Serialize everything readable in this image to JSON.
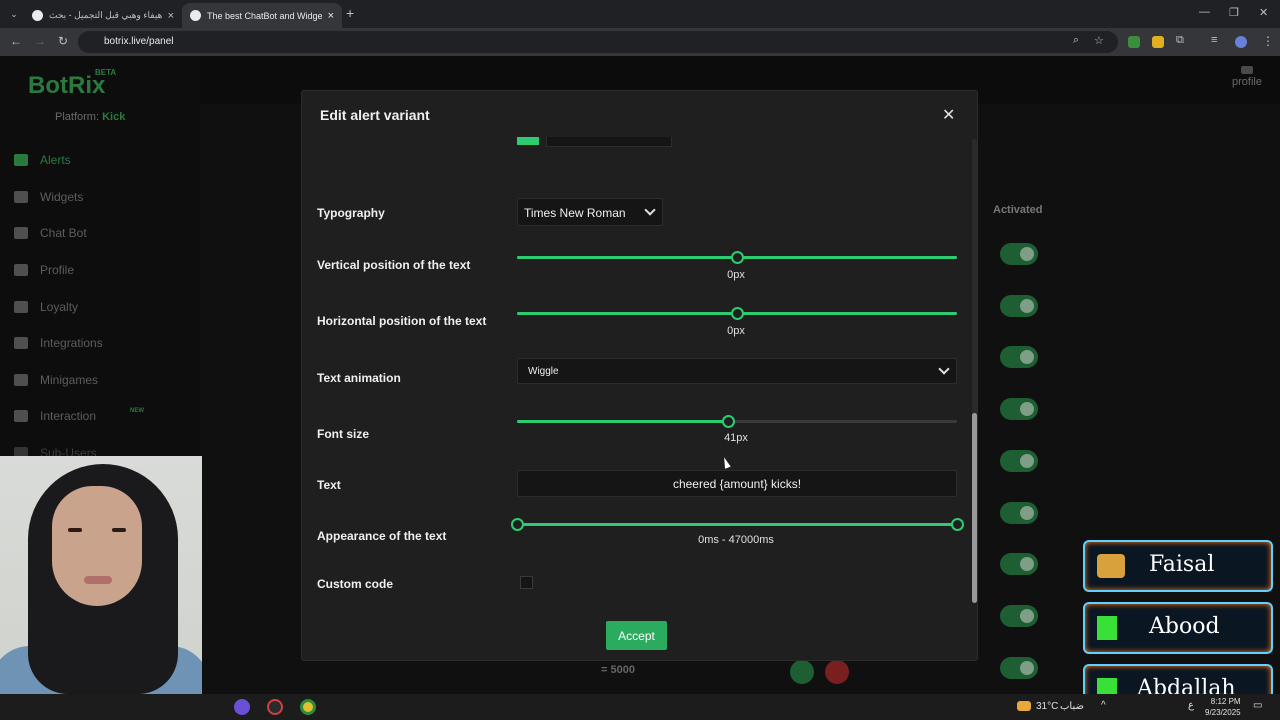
{
  "browser": {
    "tabs": [
      {
        "label": "هيفاء وهبي قبل التجميل - بحث",
        "active": false
      },
      {
        "label": "The best ChatBot and Widgets",
        "active": true
      }
    ],
    "url": "botrix.live/panel"
  },
  "app": {
    "logo": "BotRix",
    "beta": "BETA",
    "platform_label": "Platform:",
    "platform_value": "Kick",
    "profile_link": "profile",
    "nav": [
      {
        "label": "Alerts",
        "icon": "alert-icon",
        "active": true
      },
      {
        "label": "Widgets",
        "icon": "widgets-icon"
      },
      {
        "label": "Chat Bot",
        "icon": "robot-icon"
      },
      {
        "label": "Profile",
        "icon": "id-card-icon"
      },
      {
        "label": "Loyalty",
        "icon": "trophy-icon"
      },
      {
        "label": "Integrations",
        "icon": "integration-icon"
      },
      {
        "label": "Minigames",
        "icon": "gamepad-icon"
      },
      {
        "label": "Interaction",
        "icon": "music-icon",
        "badge": "NEW"
      },
      {
        "label": "Sub-Users",
        "icon": "users-icon"
      }
    ],
    "table": {
      "activated_header": "Activated",
      "row_value": "= 5000"
    }
  },
  "modal": {
    "title": "Edit alert variant",
    "accent_color": "#2ecc71",
    "fields": {
      "typography_label": "Typography",
      "typography_value": "Times New Roman",
      "vertical_label": "Vertical position of the text",
      "vertical_value": "0px",
      "vertical_fraction": 0.5,
      "horizontal_label": "Horizontal position of the text",
      "horizontal_value": "0px",
      "horizontal_fraction": 0.5,
      "animation_label": "Text animation",
      "animation_value": "Wiggle",
      "fontsize_label": "Font size",
      "fontsize_value": "41px",
      "fontsize_fraction": 0.48,
      "text_label": "Text",
      "text_value": "cheered {amount} kicks!",
      "appearance_label": "Appearance of the text",
      "appearance_value": "0ms - 47000ms",
      "custom_code_label": "Custom code",
      "custom_code_checked": false
    },
    "accept_label": "Accept"
  },
  "viewers": [
    {
      "name": "Faisal",
      "icon": "crown-icon"
    },
    {
      "name": "Abood",
      "icon": "kick-icon"
    },
    {
      "name": "Abdallah",
      "icon": "kick-icon"
    }
  ],
  "taskbar": {
    "temperature": "31°C",
    "lang": "ع",
    "weather_word": "ضباب",
    "time": "8:12 PM",
    "date": "9/23/2025"
  }
}
